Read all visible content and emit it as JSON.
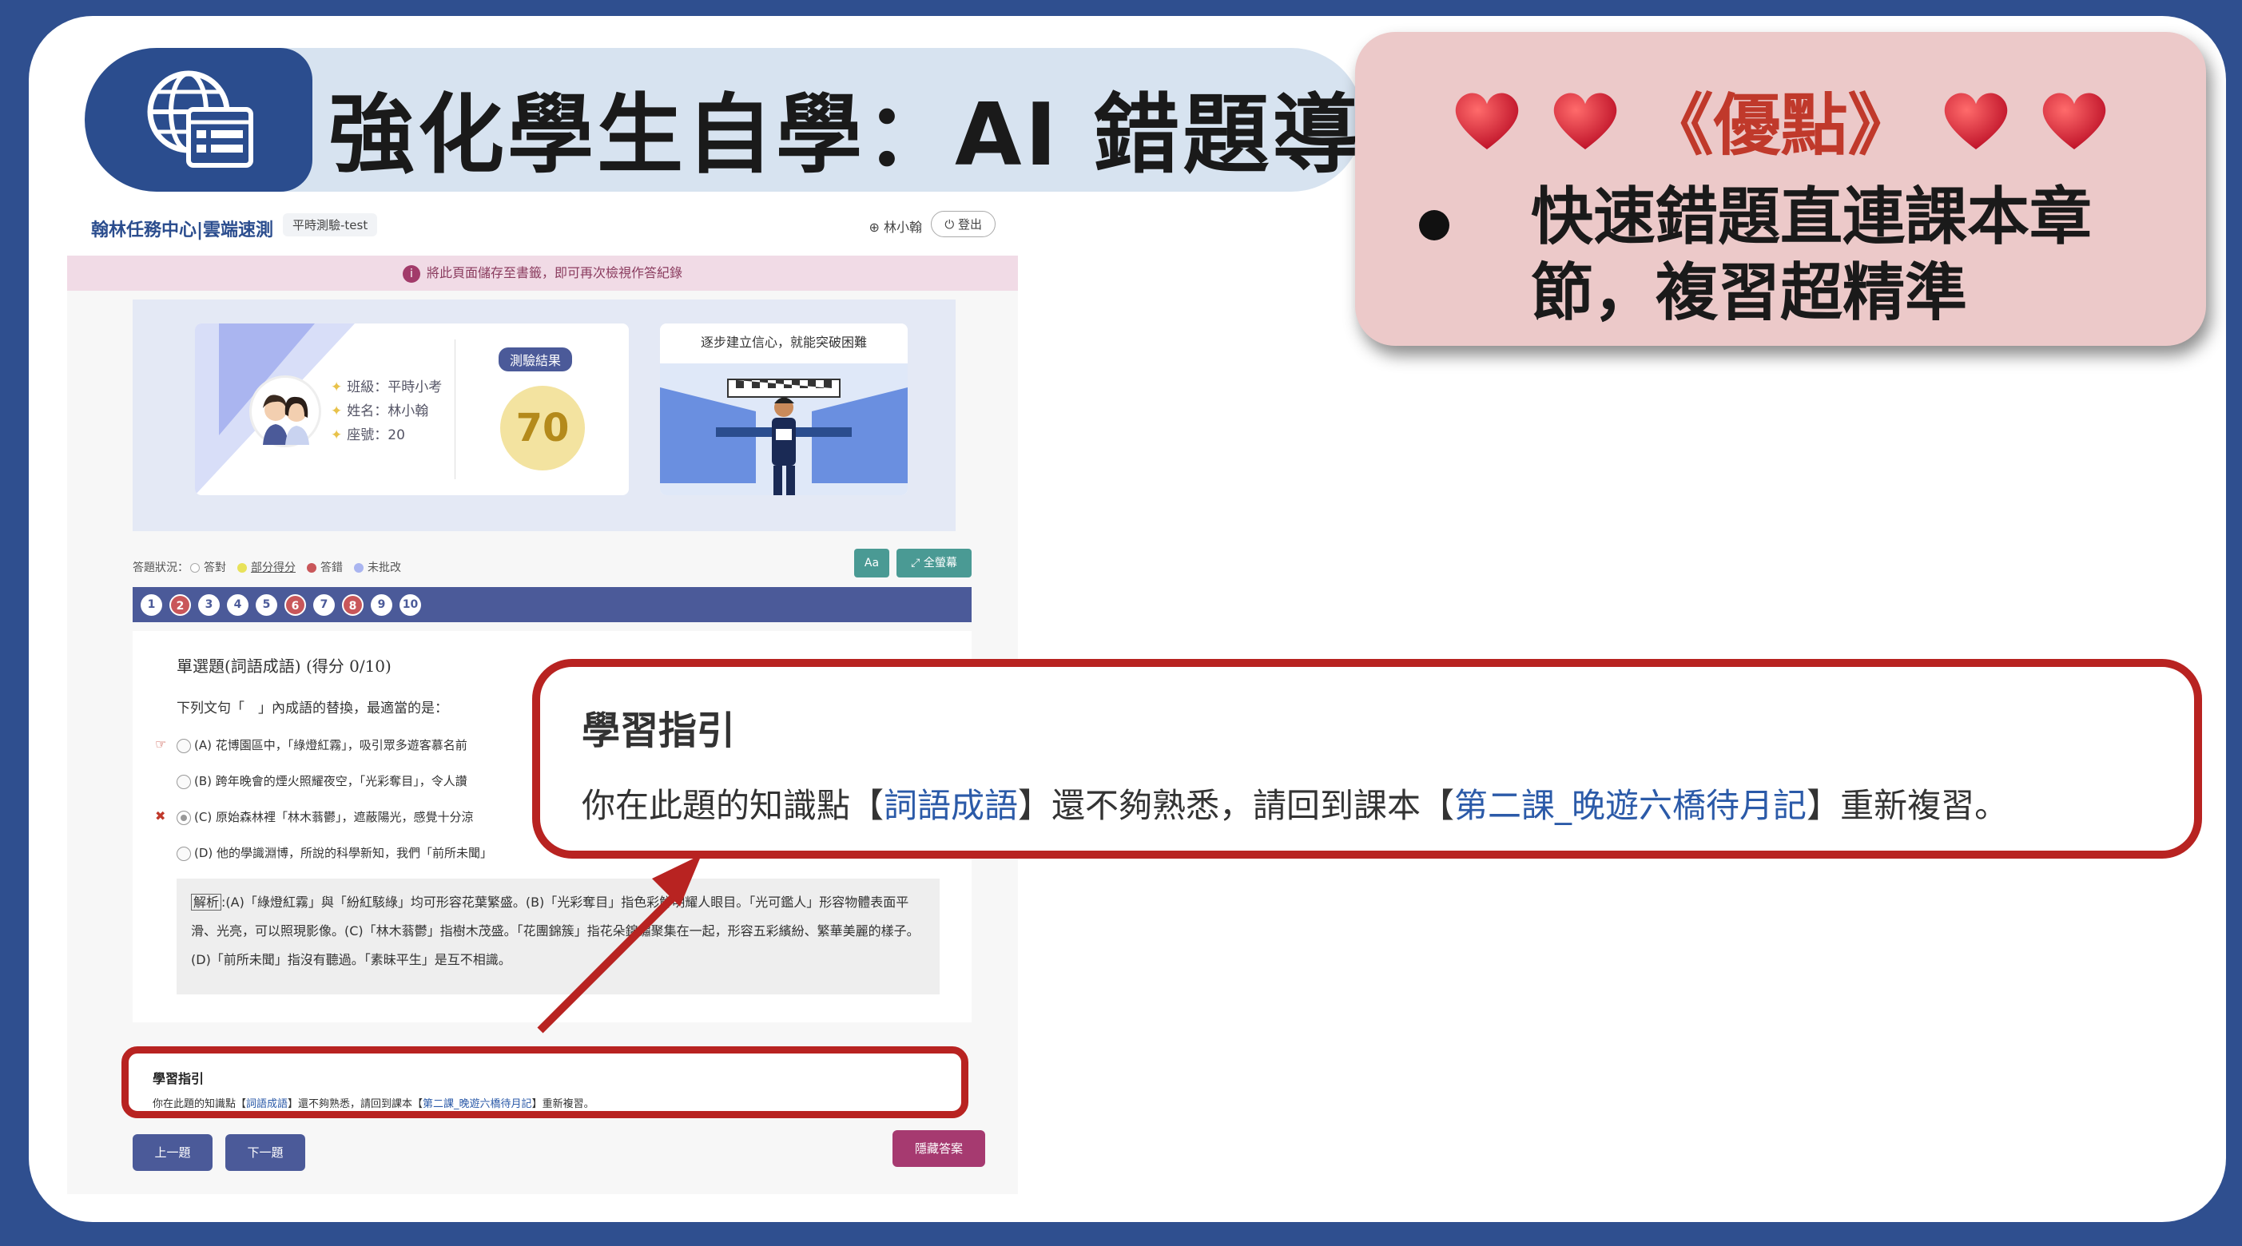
{
  "title": "強化學生自學：AI 錯題導航",
  "advantages": {
    "heading": "《優點》",
    "bullet": "快速錯題直連課本章節，複習超精準"
  },
  "screenshot": {
    "brand": "翰林任務中心|雲端速測",
    "exam_tag": "平時測驗-test",
    "user": "林小翰",
    "logout": "登出",
    "notice": "將此頁面儲存至書籤，即可再次檢視作答紀錄",
    "student": {
      "class": "班級：平時小考",
      "name": "姓名：林小翰",
      "seat": "座號：20"
    },
    "result_label": "測驗結果",
    "score": "70",
    "encourage": "逐步建立信心，就能突破困難",
    "legend_prefix": "答題狀況：",
    "legend": [
      {
        "label": "答對",
        "color": "#ffffff"
      },
      {
        "label": "部分得分",
        "color": "#e8e25a"
      },
      {
        "label": "答錯",
        "color": "#c9575a"
      },
      {
        "label": "未批改",
        "color": "#aab5f0"
      }
    ],
    "font_button": "Aa",
    "fullscreen_button": "全螢幕",
    "numbers": [
      "1",
      "2",
      "3",
      "4",
      "5",
      "6",
      "7",
      "8",
      "9",
      "10"
    ],
    "wrong_numbers": [
      "2",
      "6",
      "8"
    ],
    "question": {
      "title": "單選題(詞語成語) (得分 0/10)",
      "stem": "下列文句「　」內成語的替換，最適當的是：",
      "options": [
        "(A) 花博園區中，「綠燈紅霧」，吸引眾多遊客慕名前",
        "(B) 跨年晚會的煙火照耀夜空，「光彩奪目」，令人讚",
        "(C) 原始森林裡「林木蓊鬱」，遮蔽陽光，感覺十分涼",
        "(D) 他的學識淵博，所說的科學新知，我們「前所未聞」"
      ],
      "explanation_label": "解析",
      "explanation": ":(A)「綠燈紅霧」與「紛紅駭綠」均可形容花葉繁盛。(B)「光彩奪目」指色彩鮮明耀人眼目。「光可鑑人」形容物體表面平滑、光亮，可以照現影像。(C)「林木蓊鬱」指樹木茂盛。「花團錦簇」指花朵錦繡聚集在一起，形容五彩繽紛、繁華美麗的樣子。(D)「前所未聞」指沒有聽過。「素昧平生」是互不相識。"
    },
    "guide": {
      "heading": "學習指引",
      "pre": "你在此題的知識點【",
      "topic": "詞語成語",
      "mid": "】還不夠熟悉，請回到課本【",
      "lesson": "第二課_晚遊六橋待月記",
      "post": "】重新複習。"
    },
    "prev_button": "上一題",
    "next_button": "下一題",
    "hide_button": "隱藏答案"
  },
  "zoom_guide": {
    "heading": "學習指引",
    "pre": "你在此題的知識點【",
    "topic": "詞語成語",
    "mid": "】還不夠熟悉，請回到課本【",
    "lesson": "第二課_晚遊六橋待月記",
    "post": "】重新複習。"
  },
  "colors": {
    "background": "#2f4f8f",
    "accent_red": "#b82321",
    "nav_blue": "#4b5a99",
    "title_bg": "#d7e3f0",
    "adv_bg": "#ecc9c9"
  }
}
